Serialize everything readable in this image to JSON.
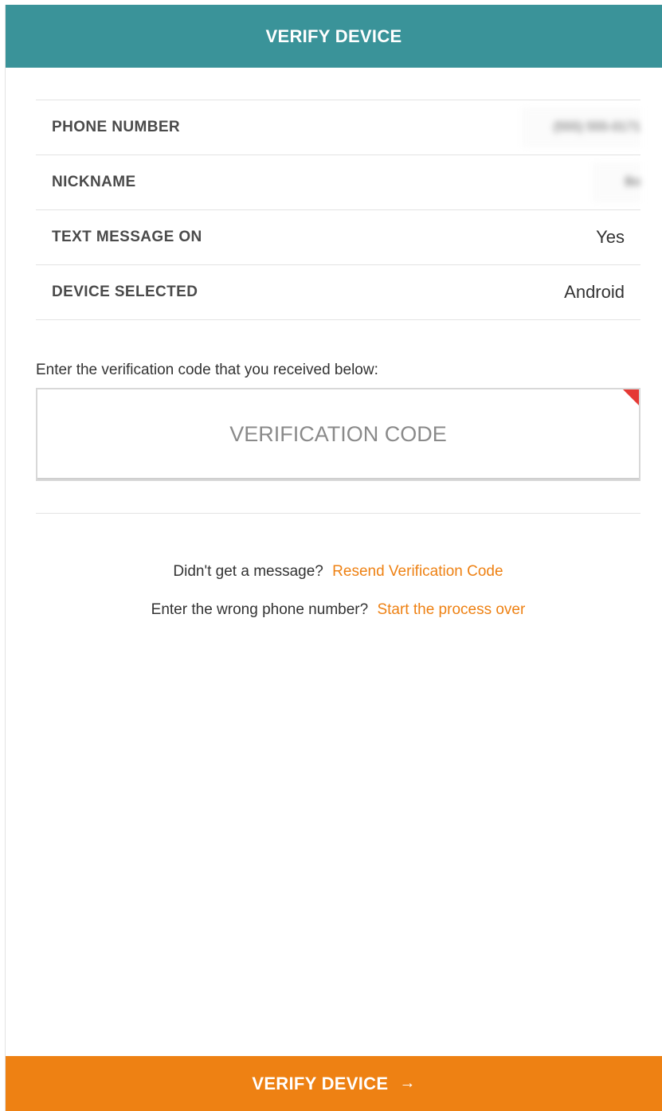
{
  "colors": {
    "header_bg": "#3a9399",
    "accent": "#ee8113",
    "required": "#e53935"
  },
  "header": {
    "title": "VERIFY DEVICE"
  },
  "details": [
    {
      "label": "PHONE NUMBER",
      "value": "(555) 555-0171"
    },
    {
      "label": "NICKNAME",
      "value": "Bo"
    },
    {
      "label": "TEXT MESSAGE ON",
      "value": "Yes"
    },
    {
      "label": "DEVICE SELECTED",
      "value": "Android"
    }
  ],
  "verification": {
    "prompt": "Enter the verification code that you received below:",
    "placeholder": "VERIFICATION CODE",
    "value": ""
  },
  "help": {
    "resend_question": "Didn't get a message?",
    "resend_link": "Resend Verification Code",
    "restart_question": "Enter the wrong phone number?",
    "restart_link": "Start the process over"
  },
  "footer": {
    "button_label": "VERIFY DEVICE",
    "button_icon": "arrow-right-icon"
  }
}
